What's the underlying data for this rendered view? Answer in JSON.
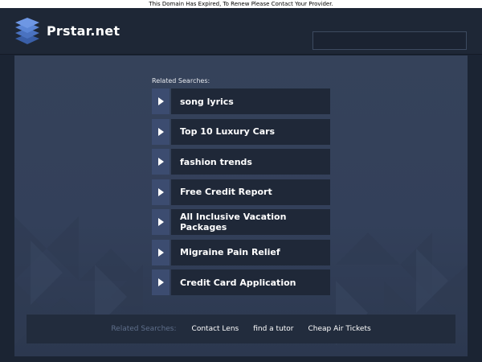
{
  "banner": {
    "text": "This Domain Has Expired, To Renew Please Contact Your Provider."
  },
  "header": {
    "site_name": "Prstar.net",
    "search_value": ""
  },
  "related": {
    "title": "Related Searches:",
    "links": [
      {
        "label": "song lyrics"
      },
      {
        "label": "Top 10 Luxury Cars"
      },
      {
        "label": "fashion trends"
      },
      {
        "label": "Free Credit Report"
      },
      {
        "label": "All Inclusive Vacation Packages"
      },
      {
        "label": "Migraine Pain Relief"
      },
      {
        "label": "Credit Card Application"
      }
    ]
  },
  "footer": {
    "label": "Related Searches:",
    "links": [
      {
        "label": "Contact Lens"
      },
      {
        "label": "find a tutor"
      },
      {
        "label": "Cheap Air Tickets"
      }
    ]
  },
  "colors": {
    "page_bg": "#1b2433",
    "panel_bg": "#35425a",
    "link_bg": "#1f2838",
    "arrow_bg": "#3c4c70",
    "muted_text": "#5f6f8b"
  }
}
